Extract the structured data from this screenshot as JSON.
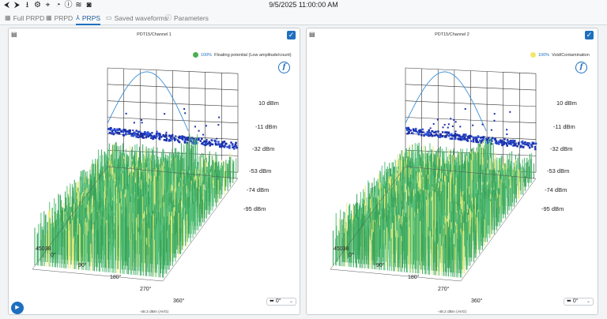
{
  "window": {
    "datetime": "9/5/2025 11:00:00 AM"
  },
  "toolbar_icons": [
    "back-arrow-icon",
    "forward-arrow-icon",
    "download-icon",
    "settings-icon",
    "crosshair-icon",
    "timer-icon",
    "info-icon",
    "layers-icon",
    "camera-icon"
  ],
  "tabs": [
    {
      "label": "Full PRPD",
      "icon": "grid-icon"
    },
    {
      "label": "PRPD",
      "icon": "grid-icon"
    },
    {
      "label": "PRPS",
      "icon": "axes-icon",
      "active": true
    },
    {
      "label": "Saved waveforms",
      "icon": "waveform-icon"
    },
    {
      "label": "Parameters",
      "icon": "info-icon"
    }
  ],
  "panels": [
    {
      "title": "PDT15/Channel 1",
      "legend": {
        "pct": "100%",
        "text": "Floating potential (Low amplitude/count)",
        "color": "#4caf50"
      },
      "dbm": [
        "10 dBm",
        "-11 dBm",
        "-32 dBm",
        "-53 dBm",
        "-74 dBm",
        "-95 dBm"
      ],
      "cycles": "45038",
      "phase": [
        "0°",
        "90°",
        "180°",
        "270°",
        "360°"
      ],
      "footer": "-48.3 dBm (AVG)",
      "rotation": "0°",
      "accent": "#1f6fbf"
    },
    {
      "title": "PDT15/Channel 2",
      "legend": {
        "pct": "100%",
        "text": "Void/Contamination",
        "color": "#f5e66b"
      },
      "dbm": [
        "10 dBm",
        "-11 dBm",
        "-32 dBm",
        "-53 dBm",
        "-74 dBm",
        "-95 dBm"
      ],
      "cycles": "45038",
      "phase": [
        "0°",
        "90°",
        "180°",
        "270°",
        "360°"
      ],
      "footer": "-48.2 dBm (AVG)",
      "rotation": "0°",
      "accent": "#1f6fbf"
    }
  ]
}
